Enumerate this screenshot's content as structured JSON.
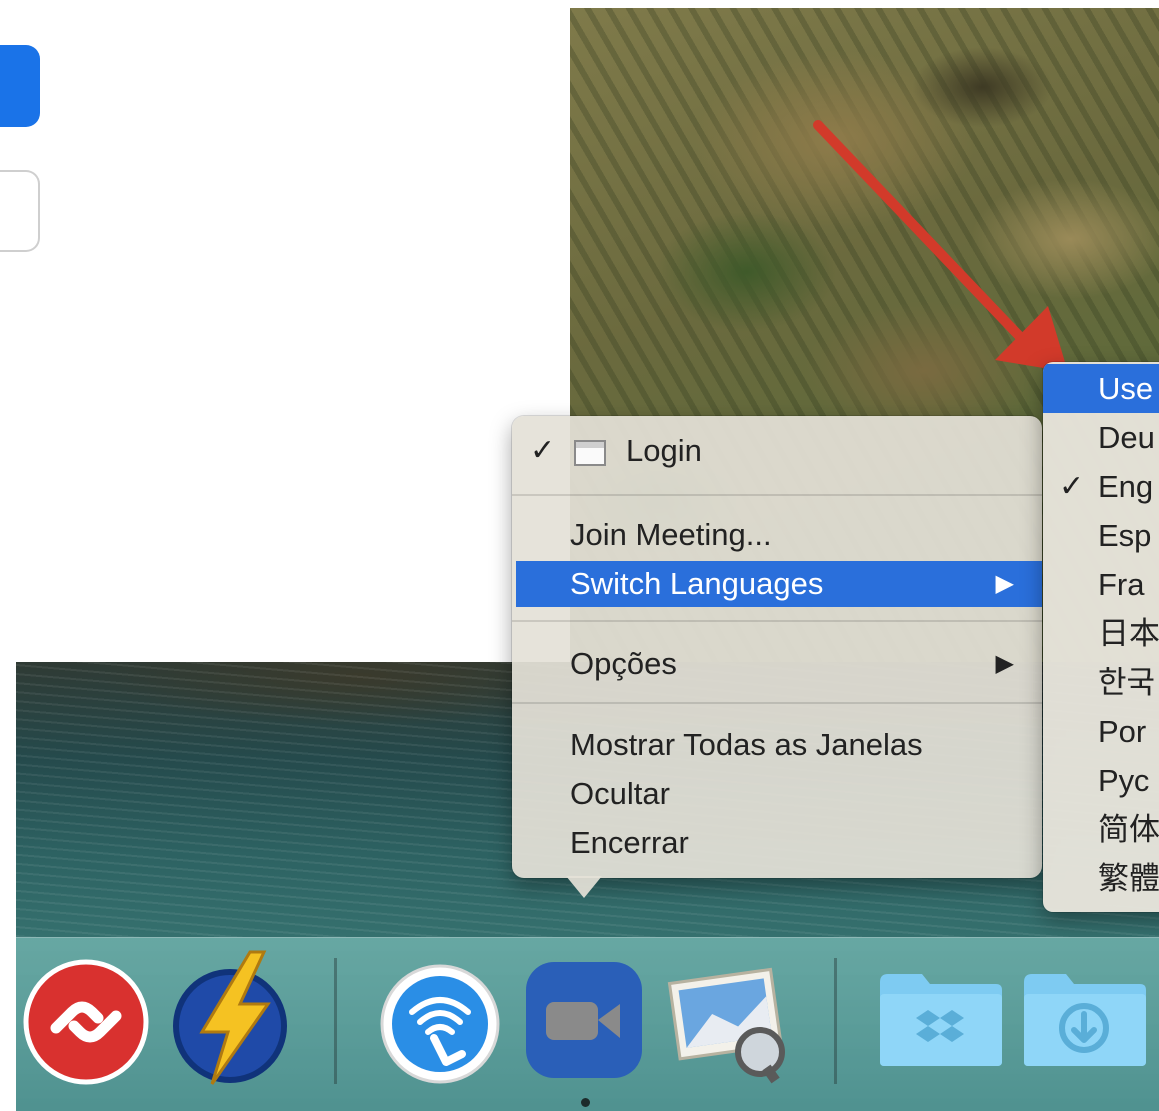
{
  "context_menu": {
    "items": [
      {
        "label": "Login",
        "checked": true,
        "icon": "window-icon"
      },
      {
        "label": "Join Meeting..."
      },
      {
        "label": "Switch Languages",
        "highlighted": true,
        "submenu": true
      },
      {
        "label": "Opções",
        "submenu": true
      },
      {
        "label": "Mostrar Todas as Janelas"
      },
      {
        "label": "Ocultar"
      },
      {
        "label": "Encerrar"
      }
    ]
  },
  "languages_submenu": {
    "items": [
      {
        "label": "Use",
        "highlighted": true
      },
      {
        "label": "Deu"
      },
      {
        "label": "Eng",
        "checked": true
      },
      {
        "label": "Esp"
      },
      {
        "label": "Fra"
      },
      {
        "label": "日本"
      },
      {
        "label": "한국"
      },
      {
        "label": "Por"
      },
      {
        "label": "Рус"
      },
      {
        "label": "简体"
      },
      {
        "label": "繁體"
      }
    ]
  },
  "checkmark": "✓",
  "submenu_arrow": "▶",
  "dock": {
    "apps": [
      {
        "name": "authy",
        "icon": "authy-icon"
      },
      {
        "name": "reeder",
        "icon": "lightning-icon"
      },
      {
        "name": "wifi-explorer",
        "icon": "wifi-hand-icon"
      },
      {
        "name": "zoom",
        "icon": "video-camera-icon",
        "running": true
      },
      {
        "name": "preview",
        "icon": "photo-magnifier-icon"
      },
      {
        "name": "dropbox-folder",
        "icon": "dropbox-folder-icon"
      },
      {
        "name": "downloads-folder",
        "icon": "downloads-folder-icon"
      }
    ]
  },
  "colors": {
    "highlight": "#2a6fdb",
    "arrow": "#d23a2a",
    "zoom_blue": "#2a5fb8",
    "authy_red": "#d9312f"
  }
}
